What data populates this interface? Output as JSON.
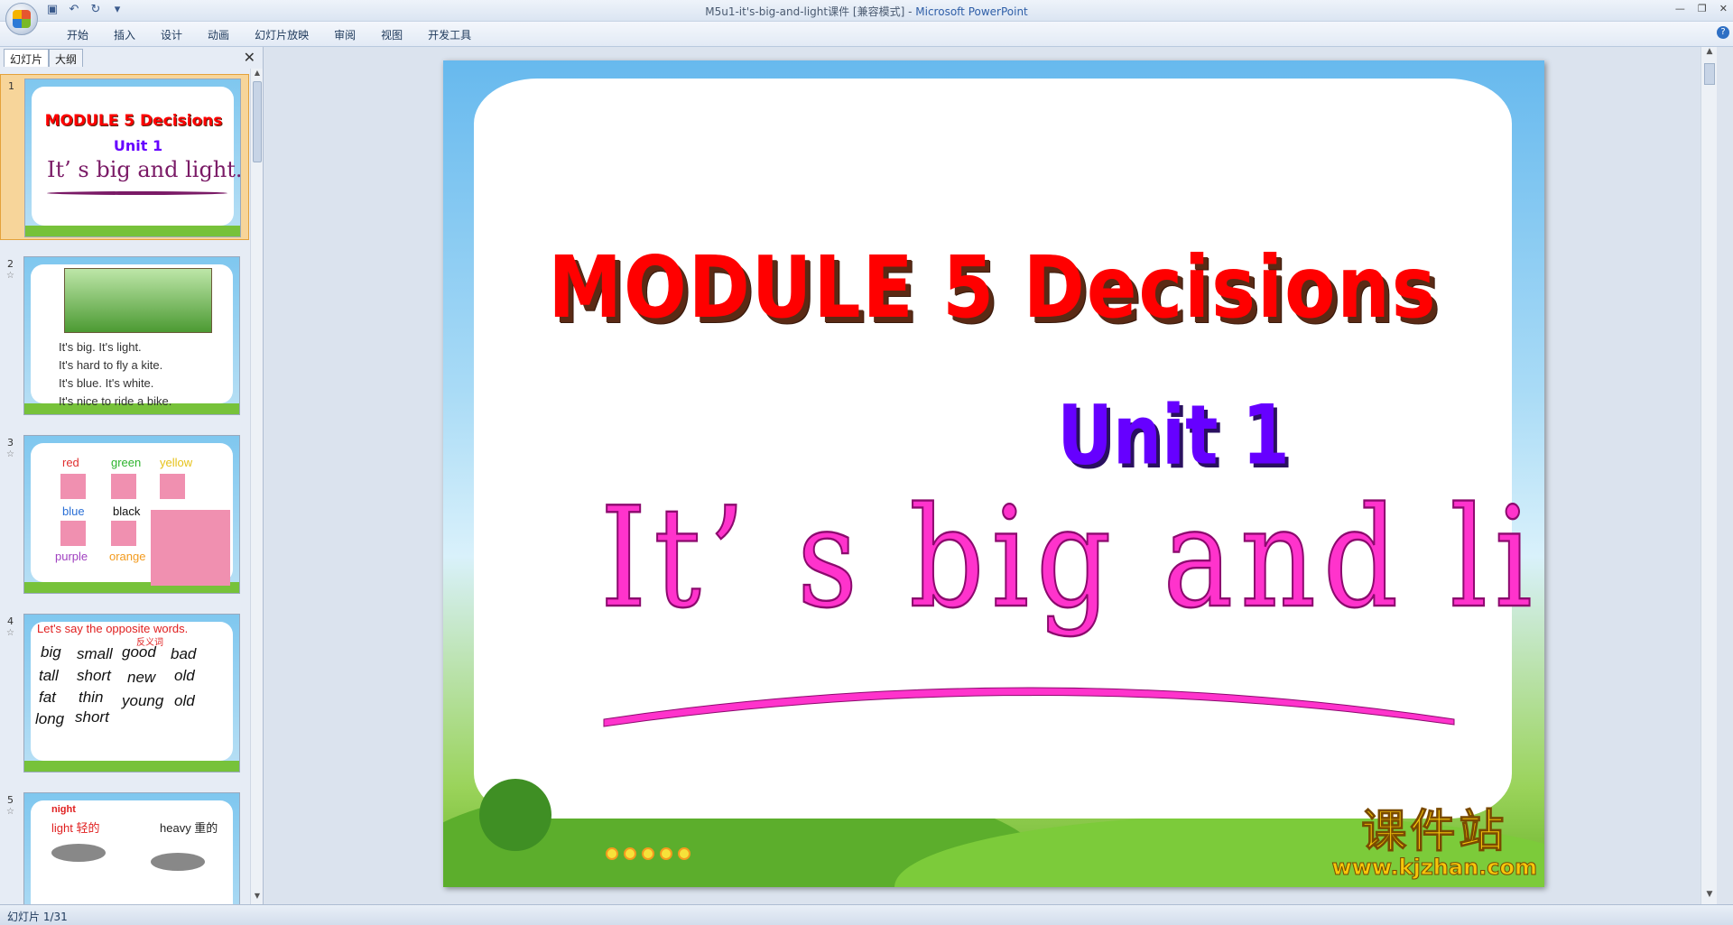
{
  "window": {
    "title_doc": "M5u1-it's-big-and-light课件 [兼容模式] - ",
    "title_app": "Microsoft PowerPoint"
  },
  "ribbon": {
    "tabs": [
      "开始",
      "插入",
      "设计",
      "动画",
      "幻灯片放映",
      "审阅",
      "视图",
      "开发工具"
    ]
  },
  "panel": {
    "tab_slides": "幻灯片",
    "tab_outline": "大纲",
    "close": "✕"
  },
  "thumbnails": [
    {
      "num": "1",
      "line1": "MODULE 5   Decisions",
      "line2": "Unit 1",
      "line3": "It’ s big and light."
    },
    {
      "num": "2",
      "lines": [
        "It's big.  It's light.",
        "It's hard to fly a kite.",
        "It's blue.  It's white.",
        "It's nice to ride a bike."
      ]
    },
    {
      "num": "3",
      "colors": [
        "red",
        "green",
        "yellow",
        "blue",
        "black",
        "purple",
        "orange"
      ]
    },
    {
      "num": "4",
      "header": "Let's say the opposite words.",
      "header_underlined": "opposite words.",
      "cn": "反义词",
      "words": [
        "big",
        "small",
        "good",
        "bad",
        "tall",
        "short",
        "new",
        "old",
        "fat",
        "thin",
        "young",
        "old",
        "long",
        "short"
      ]
    },
    {
      "num": "5",
      "w1": "night",
      "w2": "light 轻的",
      "w3": "heavy 重的"
    }
  ],
  "slide": {
    "title": "MODULE  5    Decisions",
    "unit": "Unit 1",
    "main": "It’ s big and light.",
    "watermark_cn": "课件站",
    "watermark_url": "www.kjzhan.com"
  },
  "status": {
    "text": "幻灯片 1/31"
  },
  "colors": {
    "title_red": "#ff0000",
    "unit_purple": "#6600ff",
    "main_magenta": "#ff33cc"
  }
}
